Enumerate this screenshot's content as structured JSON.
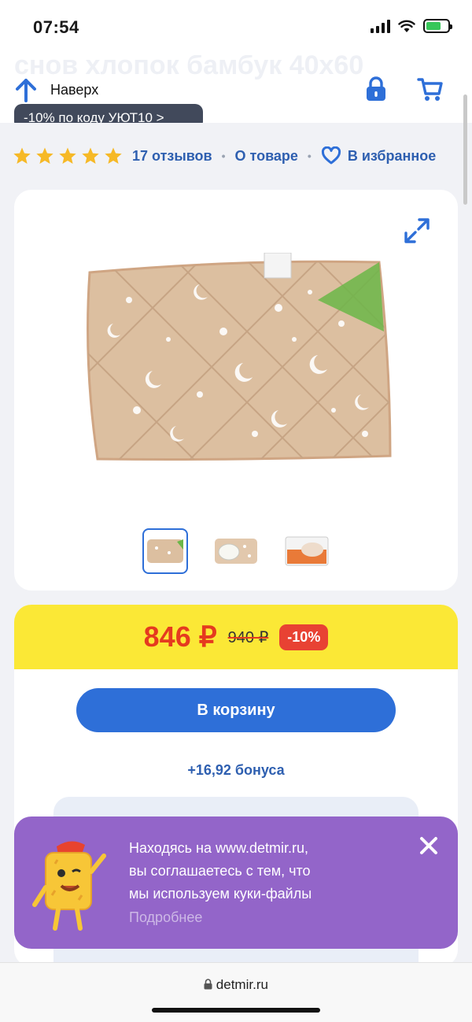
{
  "status_bar": {
    "time": "07:54"
  },
  "header": {
    "ghost_title": "снов хлопок бамбук 40х60",
    "ghost_promo": "-10% по коду УЮТ10  >",
    "up_label": "Наверх"
  },
  "rating": {
    "stars": 5,
    "reviews": "17 отзывов",
    "about": "О товаре",
    "favorite": "В избранное"
  },
  "gallery": {
    "thumbnails": [
      "pillow-front",
      "pillow-open",
      "pillow-package"
    ],
    "active_index": 0
  },
  "price": {
    "current": "846 ₽",
    "old": "940 ₽",
    "discount": "-10%"
  },
  "actions": {
    "add_to_cart": "В корзину",
    "bonus": "+16,92 бонуса"
  },
  "cookie_banner": {
    "line1": "Находясь на www.detmir.ru,",
    "line2": "вы соглашаетесь с тем, что",
    "line3": "мы используем куки-файлы",
    "more": "Подробнее"
  },
  "browser": {
    "url": "detmir.ru"
  },
  "colors": {
    "accent_blue": "#2e6fd8",
    "price_red": "#e53a1f",
    "price_band": "#fbe836",
    "cookie_purple": "#9365c9",
    "star": "#f6b927"
  }
}
